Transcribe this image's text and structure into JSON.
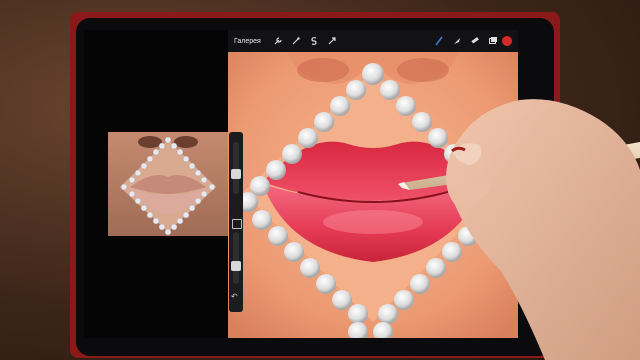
{
  "toolbar": {
    "gallery_label": "Галерея",
    "tools": [
      {
        "name": "wrench-icon"
      },
      {
        "name": "magic-wand-icon"
      },
      {
        "name": "selection-s-icon"
      },
      {
        "name": "transform-arrow-icon"
      }
    ],
    "brush_tools": [
      {
        "name": "brush-icon"
      },
      {
        "name": "smudge-icon"
      },
      {
        "name": "eraser-icon"
      },
      {
        "name": "layers-icon"
      }
    ],
    "active_color": "#d42a2a",
    "accent_color": "#3a7bd5"
  },
  "sidebar": {
    "size_slider_level": 0.35,
    "opacity_slider_level": 0.3
  },
  "colors": {
    "case": "#8a1a1a",
    "skin": "#f2a37c",
    "lips": "#e0324a",
    "pearl": "#e9e6e6"
  }
}
